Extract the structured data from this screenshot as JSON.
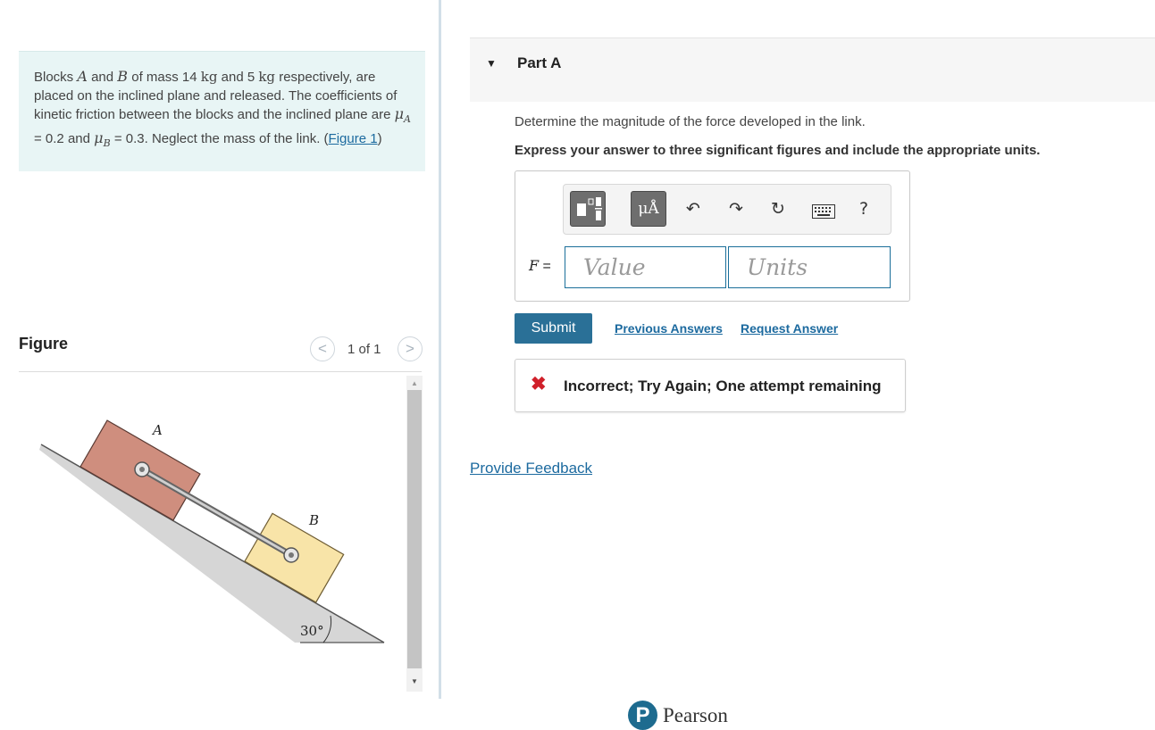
{
  "problem": {
    "text_1": "Blocks ",
    "var_a": "A",
    "text_2": " and ",
    "var_b": "B",
    "text_3": " of mass 14 ",
    "unit_1": "kg",
    "text_4": " and 5 ",
    "unit_2": "kg",
    "text_5": " respectively, are placed on the inclined plane and released. The coefficients of kinetic friction between the blocks and the inclined plane are ",
    "mu_a_symbol": "μ",
    "mu_a_sub": "A",
    "text_6": " = 0.2 and ",
    "mu_b_symbol": "μ",
    "mu_b_sub": "B",
    "text_7": " = 0.3. Neglect the mass of the link. (",
    "figure_link": "Figure 1",
    "text_8": ")"
  },
  "figure": {
    "heading": "Figure",
    "counter": "1 of 1",
    "prev_icon": "<",
    "next_icon": ">",
    "label_a": "A",
    "label_b": "B",
    "angle_label": "30°",
    "block_a_color": "#cf8e7e",
    "block_b_color": "#f8e4a8"
  },
  "part": {
    "caret_icon": "▼",
    "title": "Part A",
    "question": "Determine the magnitude of the force developed in the link.",
    "instruction": "Express your answer to three significant figures and include the appropriate units."
  },
  "toolbar": {
    "units_label": "μÅ",
    "undo_icon": "↶",
    "redo_icon": "↷",
    "reset_icon": "↻",
    "keyboard_icon": "keyboard-icon",
    "help_label": "?"
  },
  "answer": {
    "variable": "F",
    "equals": " =",
    "value_placeholder": "Value",
    "units_placeholder": "Units"
  },
  "actions": {
    "submit_label": "Submit",
    "previous_answers": "Previous Answers",
    "request_answer": "Request Answer"
  },
  "feedback": {
    "icon": "✖",
    "message": "Incorrect; Try Again; One attempt remaining",
    "provide_feedback": "Provide Feedback"
  },
  "footer": {
    "logo_letter": "P",
    "brand": "Pearson"
  },
  "colors": {
    "accent": "#2a7097",
    "link": "#1c6a9f",
    "error": "#d0202a",
    "problem_bg": "#e8f5f5"
  }
}
